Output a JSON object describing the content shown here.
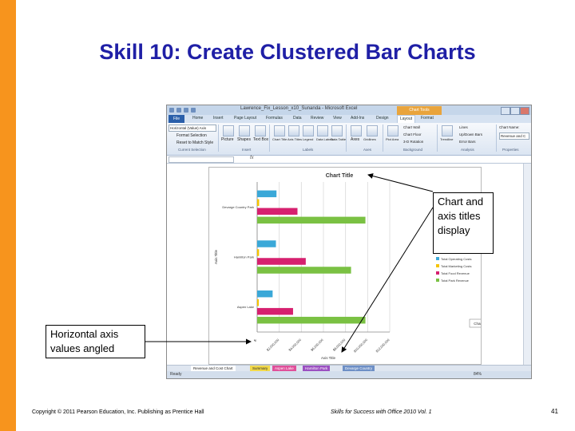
{
  "slide": {
    "title": "Skill 10: Create Clustered Bar Charts",
    "footer_copyright": "Copyright © 2011 Pearson Education, Inc. Publishing as Prentice Hall",
    "footer_series": "Skills for Success with Office 2010 Vol. 1",
    "page_number": "41"
  },
  "callouts": {
    "titles": "Chart and axis titles display",
    "values": "Horizontal axis values angled"
  },
  "excel": {
    "window_title": "Lawrence_Fix_Lesson_x10_Sunanda - Microsoft Excel",
    "context_tools": "Chart Tools",
    "tabs": [
      "Home",
      "Insert",
      "Page Layout",
      "Formulas",
      "Data",
      "Review",
      "View",
      "Add-Ins",
      "Design",
      "Layout",
      "Format"
    ],
    "file_tab": "File",
    "ribbon": {
      "selection_box": "Horizontal (Value) Axis",
      "format_selection": "Format Selection",
      "reset_style": "Reset to Match Style",
      "group_current_selection": "Current Selection",
      "group_insert": "Insert",
      "group_labels": "Labels",
      "group_axes": "Axes",
      "group_background": "Background",
      "group_analysis": "Analysis",
      "group_properties": "Properties",
      "insert_items": [
        "Picture",
        "Shapes",
        "Text Box"
      ],
      "label_items": [
        "Chart Title",
        "Axis Titles",
        "Legend",
        "Data Labels",
        "Data Table"
      ],
      "axes_items": [
        "Axes",
        "Gridlines"
      ],
      "background_items": [
        "Plot Area"
      ],
      "background_side": [
        "Chart Wall",
        "Chart Floor",
        "3-D Rotation"
      ],
      "analysis_items": [
        "Trendline"
      ],
      "analysis_side": [
        "Lines",
        "Up/Down Bars",
        "Error Bars"
      ],
      "chart_name_label": "Chart Name:",
      "chart_name_value": "Revenue and C"
    },
    "formula_fx": "fx",
    "sheet_tabs": [
      "Revenue and Cost Chart",
      "Summary",
      "Aspen Lake",
      "Hamilton Park",
      "Devarge Country"
    ],
    "status": "Ready",
    "zoom": "84%"
  },
  "chart_data": {
    "type": "bar",
    "title": "Chart Title",
    "xlabel": "Axis Title",
    "ylabel": "Axis Title",
    "categories": [
      "Aspen Lake",
      "Hamilton Park",
      "Devarge Country Park"
    ],
    "series": [
      {
        "name": "Total Operating Costs",
        "color": "#3aa8d8",
        "values": [
          1400000,
          1700000,
          1750000
        ]
      },
      {
        "name": "Total Marketing Costs",
        "color": "#f5c400",
        "values": [
          150000,
          170000,
          180000
        ]
      },
      {
        "name": "Total Food Revenue",
        "color": "#d6206f",
        "values": [
          3250000,
          4400000,
          3650000
        ]
      },
      {
        "name": "Total Park Revenue",
        "color": "#7ac143",
        "values": [
          9800000,
          8500000,
          9800000
        ]
      }
    ],
    "tick_labels": [
      "$-",
      "$2,000,000",
      "$4,000,000",
      "$6,000,000",
      "$8,000,000",
      "$10,000,000",
      "$12,000,000"
    ],
    "xlim": [
      0,
      12000000
    ],
    "grid": true,
    "legend": "right",
    "selected_element_tooltip": "Chart Area"
  }
}
